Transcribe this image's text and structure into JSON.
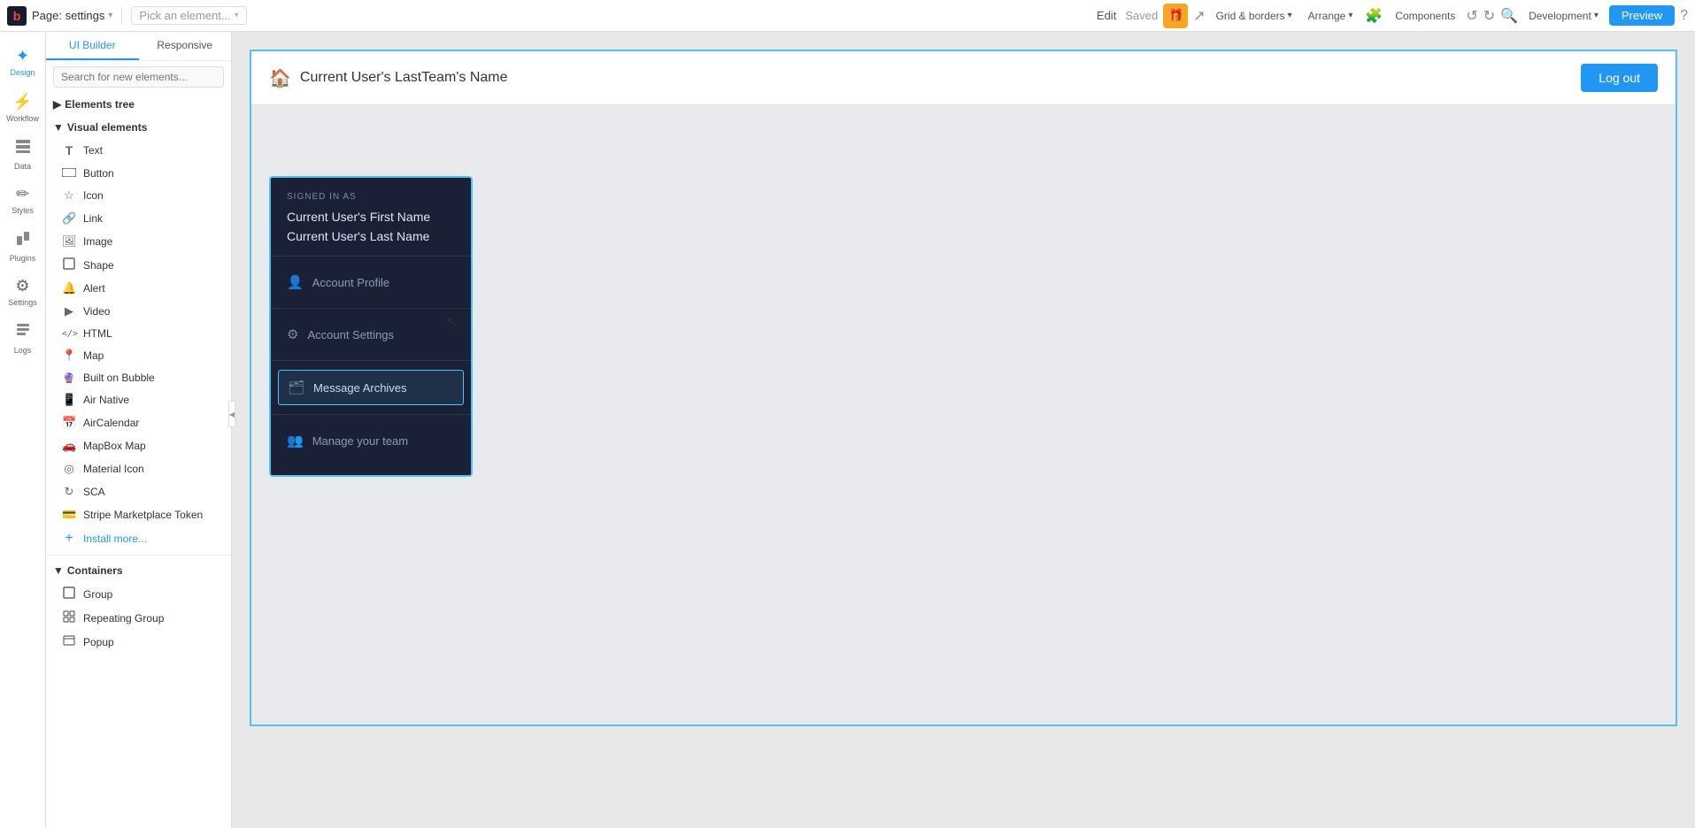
{
  "topbar": {
    "logo": "b",
    "page_label": "Page: settings",
    "pick_placeholder": "Pick an element...",
    "edit_label": "Edit",
    "saved_label": "Saved",
    "grid_borders": "Grid & borders",
    "arrange": "Arrange",
    "components": "Components",
    "development": "Development",
    "preview": "Preview"
  },
  "nav": {
    "items": [
      {
        "id": "design",
        "label": "Design",
        "icon": "✦",
        "active": true
      },
      {
        "id": "workflow",
        "label": "Workflow",
        "icon": "⚡"
      },
      {
        "id": "data",
        "label": "Data",
        "icon": "🗄"
      },
      {
        "id": "styles",
        "label": "Styles",
        "icon": "✏️"
      },
      {
        "id": "plugins",
        "label": "Plugins",
        "icon": "🔌"
      },
      {
        "id": "settings",
        "label": "Settings",
        "icon": "⚙"
      },
      {
        "id": "logs",
        "label": "Logs",
        "icon": "📋"
      }
    ]
  },
  "panel": {
    "tab_ui": "UI Builder",
    "tab_responsive": "Responsive",
    "search_placeholder": "Search for new elements...",
    "elements_tree_label": "Elements tree",
    "visual_section": "Visual elements",
    "visual_items": [
      {
        "name": "Text",
        "icon": "T"
      },
      {
        "name": "Button",
        "icon": "▭"
      },
      {
        "name": "Icon",
        "icon": "★"
      },
      {
        "name": "Link",
        "icon": "🔗"
      },
      {
        "name": "Image",
        "icon": "🖼"
      },
      {
        "name": "Shape",
        "icon": "◻"
      },
      {
        "name": "Alert",
        "icon": "🔔"
      },
      {
        "name": "Video",
        "icon": "▶"
      },
      {
        "name": "HTML",
        "icon": "</>"
      },
      {
        "name": "Map",
        "icon": "📍"
      },
      {
        "name": "Built on Bubble",
        "icon": "🔮"
      },
      {
        "name": "Air Native",
        "icon": "📱"
      },
      {
        "name": "AirCalendar",
        "icon": "📅"
      },
      {
        "name": "MapBox Map",
        "icon": "🚗"
      },
      {
        "name": "Material Icon",
        "icon": "◎"
      },
      {
        "name": "SCA",
        "icon": "↻"
      },
      {
        "name": "Stripe Marketplace Token",
        "icon": "💳"
      },
      {
        "name": "Install more...",
        "icon": "+"
      }
    ],
    "containers_section": "Containers",
    "container_items": [
      {
        "name": "Group",
        "icon": "▢"
      },
      {
        "name": "Repeating Group",
        "icon": "▣"
      },
      {
        "name": "Popup",
        "icon": "🪟"
      }
    ]
  },
  "app": {
    "header_title": "Current User's LastTeam's Name",
    "home_icon": "🏠",
    "logout_label": "Log out",
    "dropdown": {
      "signed_in_label": "SIGNED IN AS",
      "first_name": "Current User's First Name",
      "last_name": "Current User's Last Name",
      "menu_items": [
        {
          "icon": "👤",
          "label": "Account Profile"
        },
        {
          "icon": "⚙",
          "label": "Account Settings"
        },
        {
          "icon": "🗂",
          "label": "Message Archives",
          "selected": true
        },
        {
          "icon": "👥",
          "label": "Manage your team"
        }
      ]
    }
  }
}
